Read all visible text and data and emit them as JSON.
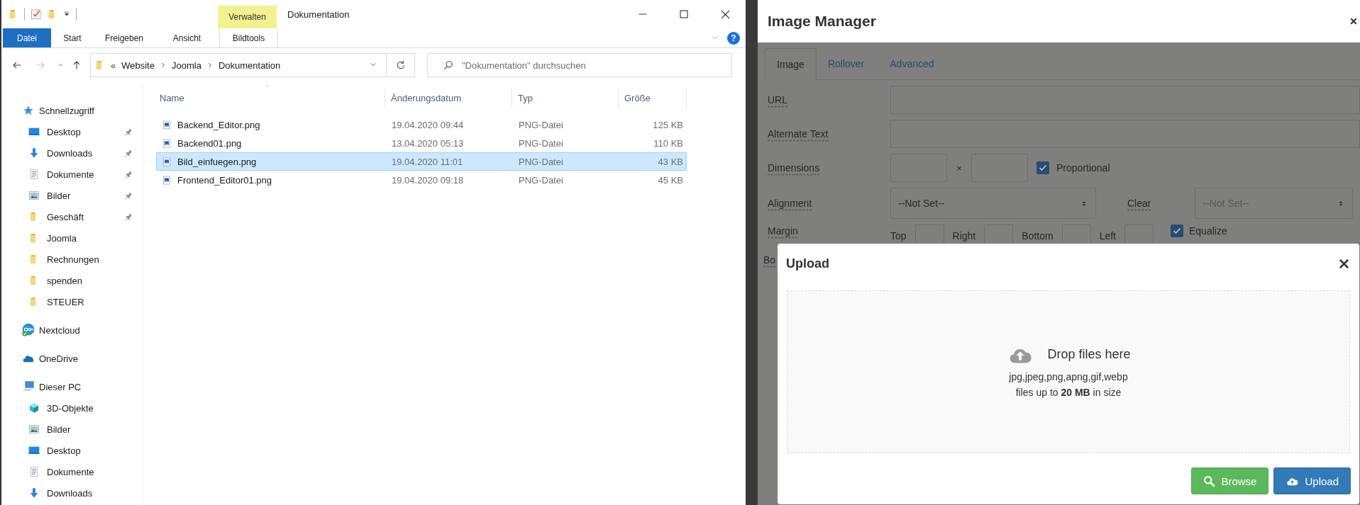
{
  "explorer": {
    "title_bar": {
      "context_group": "Verwalten",
      "title": "Dokumentation"
    },
    "ribbon_tabs": [
      {
        "label": "Datei",
        "kind": "file",
        "selected": false
      },
      {
        "label": "Start",
        "kind": "plain",
        "selected": false
      },
      {
        "label": "Freigeben",
        "kind": "plain",
        "selected": false
      },
      {
        "label": "Ansicht",
        "kind": "plain",
        "selected": false
      },
      {
        "label": "Bildtools",
        "kind": "contextual",
        "selected": false
      }
    ],
    "help": "?",
    "nav_buttons": [
      {
        "kind": "back",
        "disabled": false
      },
      {
        "kind": "forward",
        "disabled": true
      },
      {
        "kind": "recent",
        "disabled": false
      },
      {
        "kind": "up",
        "disabled": false
      }
    ],
    "address": {
      "overflow": "«",
      "path": [
        "Website",
        "Joomla",
        "Dokumentation"
      ]
    },
    "search": {
      "placeholder": "\"Dokumentation\" durchsuchen"
    },
    "sidebar": {
      "items": [
        {
          "label": "Schnellzugriff",
          "kind": "quick-access",
          "selected": false,
          "children": [
            {
              "label": "Desktop",
              "kind": "desktop",
              "pinned": true,
              "selected": false
            },
            {
              "label": "Downloads",
              "kind": "downloads",
              "pinned": true,
              "selected": false
            },
            {
              "label": "Dokumente",
              "kind": "documents",
              "pinned": true,
              "selected": false
            },
            {
              "label": "Bilder",
              "kind": "pictures",
              "pinned": true,
              "selected": false
            },
            {
              "label": "Geschäft",
              "kind": "folder",
              "pinned": true,
              "selected": false
            },
            {
              "label": "Joomla",
              "kind": "folder",
              "pinned": false,
              "selected": false
            },
            {
              "label": "Rechnungen",
              "kind": "folder",
              "pinned": false,
              "selected": false
            },
            {
              "label": "spenden",
              "kind": "folder",
              "pinned": false,
              "selected": false
            },
            {
              "label": "STEUER",
              "kind": "folder",
              "pinned": false,
              "selected": false
            }
          ]
        },
        {
          "label": "Nextcloud",
          "kind": "nextcloud",
          "selected": false
        },
        {
          "label": "OneDrive",
          "kind": "onedrive",
          "selected": false
        },
        {
          "label": "Dieser PC",
          "kind": "this-pc",
          "selected": false,
          "children": [
            {
              "label": "3D-Objekte",
              "kind": "objects",
              "selected": false
            },
            {
              "label": "Bilder",
              "kind": "pictures",
              "selected": false
            },
            {
              "label": "Desktop",
              "kind": "desktop",
              "selected": false
            },
            {
              "label": "Dokumente",
              "kind": "documents",
              "selected": false
            },
            {
              "label": "Downloads",
              "kind": "downloads",
              "selected": false
            }
          ]
        }
      ]
    },
    "file_list": {
      "columns": [
        "Name",
        "Änderungsdatum",
        "Typ",
        "Größe"
      ],
      "rows": [
        {
          "name": "Backend_Editor.png",
          "date": "19.04.2020 09:44",
          "type": "PNG-Datei",
          "size": "125 KB",
          "selected": false
        },
        {
          "name": "Backend01.png",
          "date": "13.04.2020 05:13",
          "type": "PNG-Datei",
          "size": "110 KB",
          "selected": false
        },
        {
          "name": "Bild_einfuegen.png",
          "date": "19.04.2020 11:01",
          "type": "PNG-Datei",
          "size": "43 KB",
          "selected": true
        },
        {
          "name": "Frontend_Editor01.png",
          "date": "19.04.2020 09:18",
          "type": "PNG-Datei",
          "size": "45 KB",
          "selected": false
        }
      ]
    }
  },
  "image_manager": {
    "title": "Image Manager",
    "tabs": [
      {
        "label": "Image",
        "selected": true
      },
      {
        "label": "Rollover",
        "selected": false
      },
      {
        "label": "Advanced",
        "selected": false
      }
    ],
    "form": [
      {
        "kind": "text",
        "label": "URL"
      },
      {
        "kind": "text",
        "label": "Alternate Text"
      },
      {
        "kind": "dimensions",
        "label": "Dimensions",
        "separator": "×",
        "checkbox": {
          "label": "Proportional",
          "checked": true
        }
      },
      {
        "kind": "select-pair",
        "label": "Alignment",
        "value": "--Not Set--",
        "second_label": "Clear",
        "second_value": "--Not Set--",
        "second_disabled": true
      },
      {
        "kind": "margin",
        "label": "Margin",
        "sides": [
          "Top",
          "Right",
          "Bottom",
          "Left"
        ],
        "checkbox": {
          "label": "Equalize",
          "checked": true
        }
      },
      {
        "kind": "cut",
        "label": "Bo"
      }
    ]
  },
  "upload_dialog": {
    "title": "Upload",
    "dropzone": {
      "heading": "Drop files here",
      "file_types": "jpg,jpeg,png,apng,gif,webp",
      "size_note": "files up to **20 MB** in size"
    },
    "buttons": [
      {
        "label": "Browse",
        "kind": "browse"
      },
      {
        "label": "Upload",
        "kind": "upload"
      }
    ]
  }
}
